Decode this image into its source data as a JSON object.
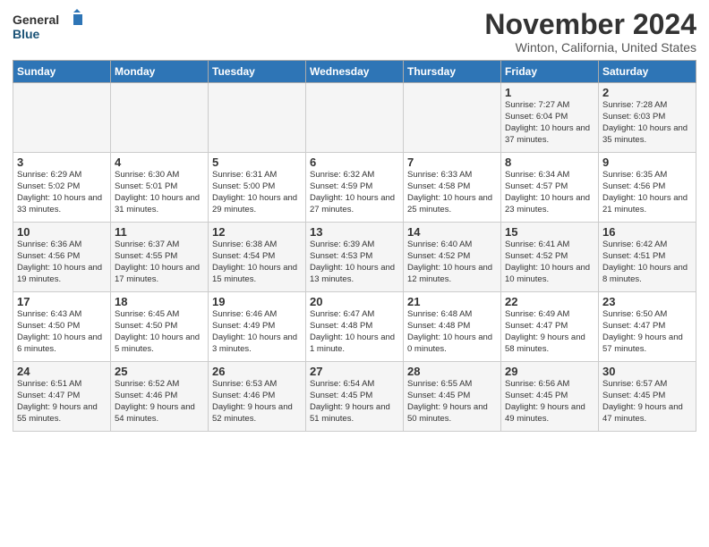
{
  "header": {
    "logo_general": "General",
    "logo_blue": "Blue",
    "month_title": "November 2024",
    "subtitle": "Winton, California, United States"
  },
  "days_of_week": [
    "Sunday",
    "Monday",
    "Tuesday",
    "Wednesday",
    "Thursday",
    "Friday",
    "Saturday"
  ],
  "weeks": [
    [
      {
        "day": "",
        "info": ""
      },
      {
        "day": "",
        "info": ""
      },
      {
        "day": "",
        "info": ""
      },
      {
        "day": "",
        "info": ""
      },
      {
        "day": "",
        "info": ""
      },
      {
        "day": "1",
        "info": "Sunrise: 7:27 AM\nSunset: 6:04 PM\nDaylight: 10 hours and 37 minutes."
      },
      {
        "day": "2",
        "info": "Sunrise: 7:28 AM\nSunset: 6:03 PM\nDaylight: 10 hours and 35 minutes."
      }
    ],
    [
      {
        "day": "3",
        "info": "Sunrise: 6:29 AM\nSunset: 5:02 PM\nDaylight: 10 hours and 33 minutes."
      },
      {
        "day": "4",
        "info": "Sunrise: 6:30 AM\nSunset: 5:01 PM\nDaylight: 10 hours and 31 minutes."
      },
      {
        "day": "5",
        "info": "Sunrise: 6:31 AM\nSunset: 5:00 PM\nDaylight: 10 hours and 29 minutes."
      },
      {
        "day": "6",
        "info": "Sunrise: 6:32 AM\nSunset: 4:59 PM\nDaylight: 10 hours and 27 minutes."
      },
      {
        "day": "7",
        "info": "Sunrise: 6:33 AM\nSunset: 4:58 PM\nDaylight: 10 hours and 25 minutes."
      },
      {
        "day": "8",
        "info": "Sunrise: 6:34 AM\nSunset: 4:57 PM\nDaylight: 10 hours and 23 minutes."
      },
      {
        "day": "9",
        "info": "Sunrise: 6:35 AM\nSunset: 4:56 PM\nDaylight: 10 hours and 21 minutes."
      }
    ],
    [
      {
        "day": "10",
        "info": "Sunrise: 6:36 AM\nSunset: 4:56 PM\nDaylight: 10 hours and 19 minutes."
      },
      {
        "day": "11",
        "info": "Sunrise: 6:37 AM\nSunset: 4:55 PM\nDaylight: 10 hours and 17 minutes."
      },
      {
        "day": "12",
        "info": "Sunrise: 6:38 AM\nSunset: 4:54 PM\nDaylight: 10 hours and 15 minutes."
      },
      {
        "day": "13",
        "info": "Sunrise: 6:39 AM\nSunset: 4:53 PM\nDaylight: 10 hours and 13 minutes."
      },
      {
        "day": "14",
        "info": "Sunrise: 6:40 AM\nSunset: 4:52 PM\nDaylight: 10 hours and 12 minutes."
      },
      {
        "day": "15",
        "info": "Sunrise: 6:41 AM\nSunset: 4:52 PM\nDaylight: 10 hours and 10 minutes."
      },
      {
        "day": "16",
        "info": "Sunrise: 6:42 AM\nSunset: 4:51 PM\nDaylight: 10 hours and 8 minutes."
      }
    ],
    [
      {
        "day": "17",
        "info": "Sunrise: 6:43 AM\nSunset: 4:50 PM\nDaylight: 10 hours and 6 minutes."
      },
      {
        "day": "18",
        "info": "Sunrise: 6:45 AM\nSunset: 4:50 PM\nDaylight: 10 hours and 5 minutes."
      },
      {
        "day": "19",
        "info": "Sunrise: 6:46 AM\nSunset: 4:49 PM\nDaylight: 10 hours and 3 minutes."
      },
      {
        "day": "20",
        "info": "Sunrise: 6:47 AM\nSunset: 4:48 PM\nDaylight: 10 hours and 1 minute."
      },
      {
        "day": "21",
        "info": "Sunrise: 6:48 AM\nSunset: 4:48 PM\nDaylight: 10 hours and 0 minutes."
      },
      {
        "day": "22",
        "info": "Sunrise: 6:49 AM\nSunset: 4:47 PM\nDaylight: 9 hours and 58 minutes."
      },
      {
        "day": "23",
        "info": "Sunrise: 6:50 AM\nSunset: 4:47 PM\nDaylight: 9 hours and 57 minutes."
      }
    ],
    [
      {
        "day": "24",
        "info": "Sunrise: 6:51 AM\nSunset: 4:47 PM\nDaylight: 9 hours and 55 minutes."
      },
      {
        "day": "25",
        "info": "Sunrise: 6:52 AM\nSunset: 4:46 PM\nDaylight: 9 hours and 54 minutes."
      },
      {
        "day": "26",
        "info": "Sunrise: 6:53 AM\nSunset: 4:46 PM\nDaylight: 9 hours and 52 minutes."
      },
      {
        "day": "27",
        "info": "Sunrise: 6:54 AM\nSunset: 4:45 PM\nDaylight: 9 hours and 51 minutes."
      },
      {
        "day": "28",
        "info": "Sunrise: 6:55 AM\nSunset: 4:45 PM\nDaylight: 9 hours and 50 minutes."
      },
      {
        "day": "29",
        "info": "Sunrise: 6:56 AM\nSunset: 4:45 PM\nDaylight: 9 hours and 49 minutes."
      },
      {
        "day": "30",
        "info": "Sunrise: 6:57 AM\nSunset: 4:45 PM\nDaylight: 9 hours and 47 minutes."
      }
    ]
  ]
}
